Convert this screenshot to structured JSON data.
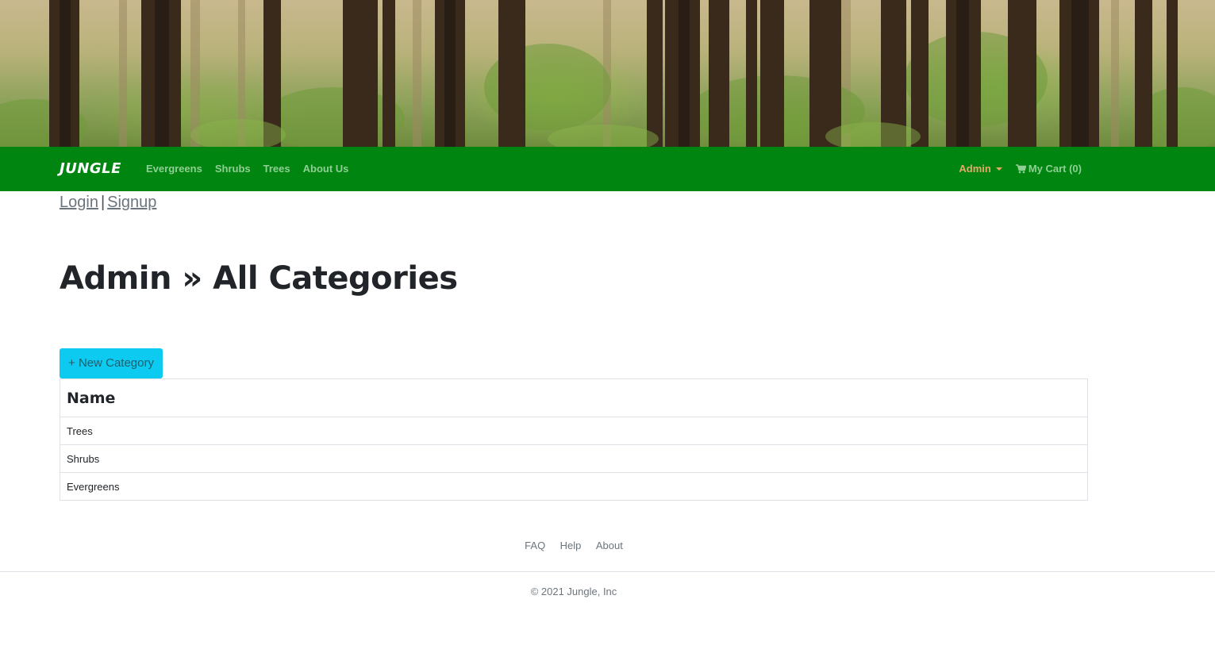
{
  "banner": {
    "alt": "forest-banner"
  },
  "navbar": {
    "brand": "JUNGLE",
    "links": [
      "Evergreens",
      "Shrubs",
      "Trees",
      "About Us"
    ],
    "admin_label": "Admin",
    "cart_label": "My Cart (0)"
  },
  "auth": {
    "login": "Login",
    "separator": "|",
    "signup": "Signup"
  },
  "page": {
    "title": "Admin » All Categories",
    "new_button": "+ New Category"
  },
  "table": {
    "header": "Name",
    "rows": [
      "Trees",
      "Shrubs",
      "Evergreens"
    ]
  },
  "footer": {
    "links": [
      "FAQ",
      "Help",
      "About"
    ],
    "copyright": "© 2021 Jungle, Inc"
  },
  "colors": {
    "navbar_bg": "#008510",
    "nav_link": "#8fcf93",
    "admin_link": "#e8a86a",
    "button_bg": "#0dcaf0"
  }
}
